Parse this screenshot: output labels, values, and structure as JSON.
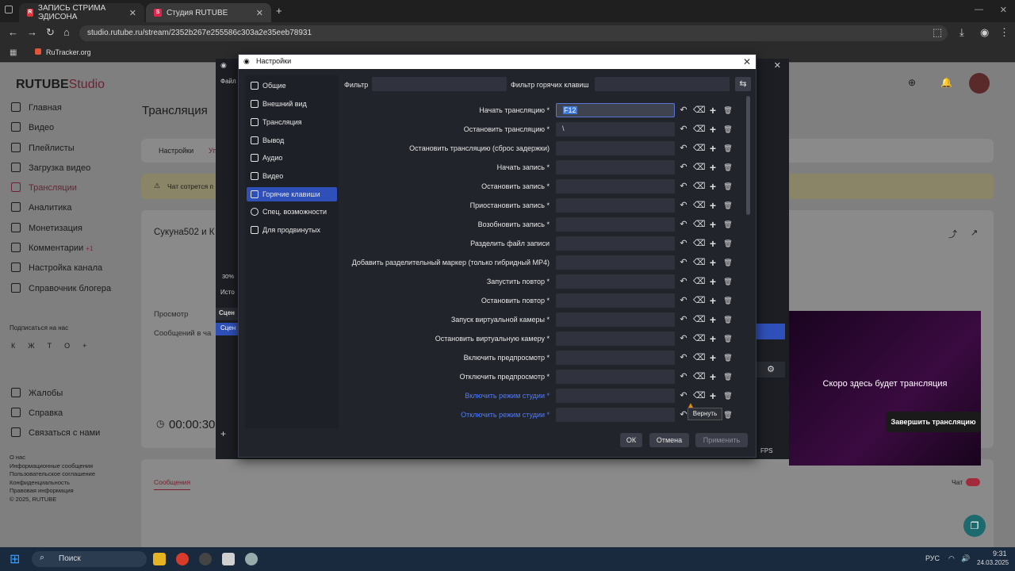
{
  "browser": {
    "tabs": [
      {
        "label": "ЗАПИСЬ СТРИМА ЭДИСОНА"
      },
      {
        "label": "Студия RUTUBE"
      }
    ],
    "new_tab": "+",
    "url": "studio.rutube.ru/stream/2352b267e255586c303a2e35eeb78931",
    "bookmark": "RuTracker.org"
  },
  "site": {
    "logo": "RUTUBE",
    "logo_suffix": "Studio",
    "page_title": "Трансляция",
    "sidebar": [
      "Главная",
      "Видео",
      "Плейлисты",
      "Загрузка видео",
      "Трансляции",
      "Аналитика",
      "Монетизация",
      "Комментарии",
      "Настройка канала",
      "Справочник блогера"
    ],
    "comments_badge": "+1",
    "subscribe_label": "Подписаться на нас",
    "social": [
      "К",
      "Ж",
      "Т",
      "О",
      "+"
    ],
    "support": [
      "Жалобы",
      "Справка",
      "Связаться с нами"
    ],
    "footer_links": [
      "О нас",
      "Информационные сообщения",
      "Пользовательское соглашение",
      "Конфиденциальность",
      "Правовая информация",
      "© 2025, RUTUBE"
    ],
    "tab_settings": "Настройки",
    "tab_other": "Уп",
    "chat_warning": "Чат сотрется п",
    "stream_name": "Сукуна502 и К",
    "views_label": "Просмотр",
    "messages_label": "Сообщений в ча",
    "timer": "00:00:30",
    "messages_tab": "Сообщения",
    "chat_label": "Чат",
    "preview_text": "Скоро здесь будет трансляция",
    "end_stream": "Завершить трансляцию"
  },
  "obs_main": {
    "percent": "30%",
    "sources_label": "Исто",
    "scenes_label": "Сцен",
    "scene_item": "Сцен",
    "fps": "FPS"
  },
  "settings": {
    "title": "Настройки",
    "nav": [
      {
        "label": "Общие",
        "icon": "gear-icon"
      },
      {
        "label": "Внешний вид",
        "icon": "appearance-icon"
      },
      {
        "label": "Трансляция",
        "icon": "antenna-icon"
      },
      {
        "label": "Вывод",
        "icon": "output-icon"
      },
      {
        "label": "Аудио",
        "icon": "speaker-icon"
      },
      {
        "label": "Видео",
        "icon": "monitor-icon"
      },
      {
        "label": "Горячие клавиши",
        "icon": "keyboard-icon"
      },
      {
        "label": "Спец. возможности",
        "icon": "accessibility-icon"
      },
      {
        "label": "Для продвинутых",
        "icon": "wrench-icon"
      }
    ],
    "active_nav": "Горячие клавиши",
    "filter_label": "Фильтр",
    "filter_value": "",
    "hotkey_filter_label": "Фильтр горячих клавиш",
    "hotkey_filter_value": "",
    "hotkeys": [
      {
        "label": "Начать трансляцию *",
        "value": "F12"
      },
      {
        "label": "Остановить трансляцию *",
        "value": "\\"
      },
      {
        "label": "Остановить трансляцию (сброс задержки)",
        "value": ""
      },
      {
        "label": "Начать запись *",
        "value": ""
      },
      {
        "label": "Остановить запись *",
        "value": ""
      },
      {
        "label": "Приостановить запись *",
        "value": ""
      },
      {
        "label": "Возобновить запись *",
        "value": ""
      },
      {
        "label": "Разделить файл записи",
        "value": ""
      },
      {
        "label": "Добавить разделительный маркер (только гибридный MP4)",
        "value": ""
      },
      {
        "label": "Запустить повтор *",
        "value": ""
      },
      {
        "label": "Остановить повтор *",
        "value": ""
      },
      {
        "label": "Запуск виртуальной камеры *",
        "value": ""
      },
      {
        "label": "Остановить виртуальную камеру *",
        "value": ""
      },
      {
        "label": "Включить предпросмотр *",
        "value": ""
      },
      {
        "label": "Отключить предпросмотр *",
        "value": ""
      },
      {
        "label": "Включить режим студии *",
        "value": ""
      },
      {
        "label": "Отключить режим студии *",
        "value": ""
      }
    ],
    "tooltip": "Вернуть",
    "ok": "ОК",
    "cancel": "Отмена",
    "apply": "Применить"
  },
  "taskbar": {
    "search": "Поиск",
    "lang": "РУС",
    "time": "9:31",
    "date": "24.03.2025"
  }
}
